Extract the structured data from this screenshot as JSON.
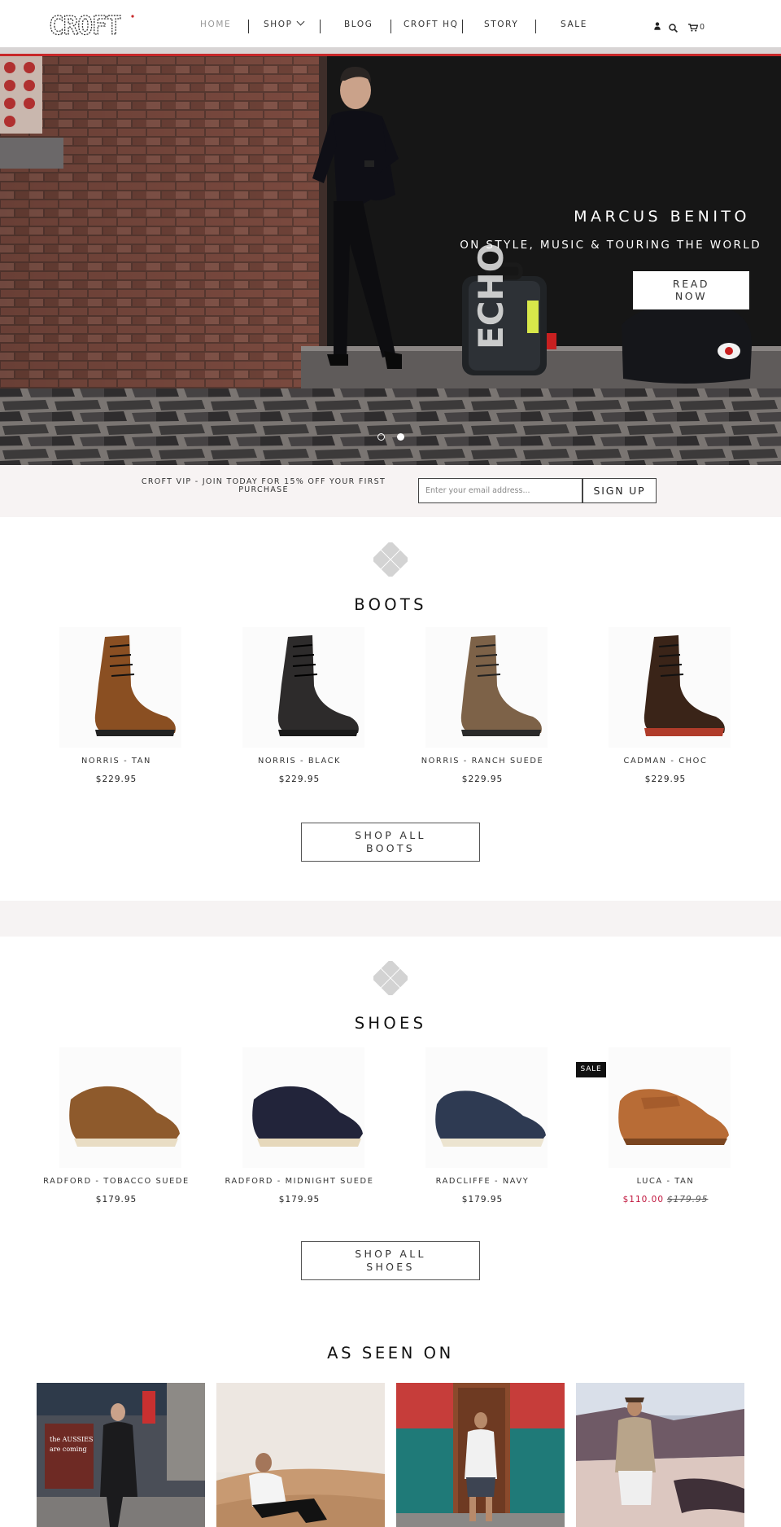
{
  "header": {
    "logo_text": "CROFT",
    "nav": [
      {
        "label": "HOME"
      },
      {
        "label": "SHOP"
      },
      {
        "label": "BLOG"
      },
      {
        "label": "CROFT HQ"
      },
      {
        "label": "STORY"
      },
      {
        "label": "SALE"
      }
    ],
    "cart_count": "0"
  },
  "hero": {
    "title": "MARCUS BENITO",
    "subtitle": "ON STYLE, MUSIC & TOURING THE WORLD",
    "button_line1": "READ",
    "button_line2": "NOW",
    "case_text": "ECHO",
    "slides": 2,
    "active_slide": 1
  },
  "vip": {
    "text": "CROFT VIP - JOIN TODAY FOR 15% OFF YOUR FIRST PURCHASE",
    "placeholder": "Enter your email address...",
    "button": "SIGN UP"
  },
  "boots": {
    "title": "BOOTS",
    "products": [
      {
        "name": "NORRIS - TAN",
        "price": "$229.95",
        "color": "#8a4f22"
      },
      {
        "name": "NORRIS - BLACK",
        "price": "$229.95",
        "color": "#2d2b2b"
      },
      {
        "name": "NORRIS - RANCH SUEDE",
        "price": "$229.95",
        "color": "#7d6248"
      },
      {
        "name": "CADMAN - CHOC",
        "price": "$229.95",
        "color": "#3a2418"
      }
    ],
    "shop_all_line1": "SHOP ALL",
    "shop_all_line2": "BOOTS"
  },
  "shoes": {
    "title": "SHOES",
    "products": [
      {
        "name": "RADFORD - TOBACCO SUEDE",
        "price": "$179.95",
        "color": "#8e5a2c"
      },
      {
        "name": "RADFORD - MIDNIGHT SUEDE",
        "price": "$179.95",
        "color": "#22243a"
      },
      {
        "name": "RADCLIFFE - NAVY",
        "price": "$179.95",
        "color": "#2e3a52"
      },
      {
        "name": "LUCA - TAN",
        "sale_price": "$110.00",
        "old_price": "$179.95",
        "badge": "SALE",
        "color": "#b86c36"
      }
    ],
    "shop_all_line1": "SHOP ALL",
    "shop_all_line2": "SHOES"
  },
  "as_seen_on": {
    "title": "AS SEEN ON",
    "sign_line1": "the AUSSIES",
    "sign_line2": "are coming"
  }
}
